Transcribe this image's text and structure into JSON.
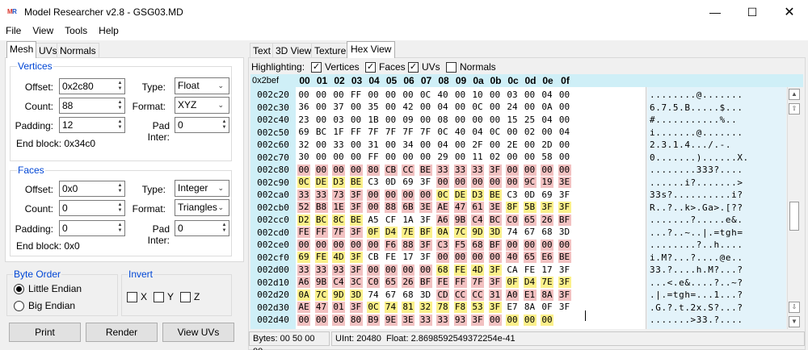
{
  "title": {
    "logo": "MR",
    "text": "Model Researcher v2.8 - GSG03.MD"
  },
  "menu": [
    "File",
    "View",
    "Tools",
    "Help"
  ],
  "left_tabs": [
    "Mesh",
    "UVs",
    "Normals"
  ],
  "vertices": {
    "title": "Vertices",
    "offset_label": "Offset:",
    "offset": "0x2c80",
    "count_label": "Count:",
    "count": "88",
    "padding_label": "Padding:",
    "padding": "12",
    "type_label": "Type:",
    "type": "Float",
    "format_label": "Format:",
    "format": "XYZ",
    "padinter_label": "Pad Inter:",
    "padinter": "0",
    "endblock": "End block: 0x34c0"
  },
  "faces": {
    "title": "Faces",
    "offset_label": "Offset:",
    "offset": "0x0",
    "count_label": "Count:",
    "count": "0",
    "padding_label": "Padding:",
    "padding": "0",
    "type_label": "Type:",
    "type": "Integer",
    "format_label": "Format:",
    "format": "Triangles",
    "padinter_label": "Pad Inter:",
    "padinter": "0",
    "endblock": "End block: 0x0"
  },
  "byte_order": {
    "title": "Byte Order",
    "little": "Little Endian",
    "big": "Big Endian",
    "selected": "Little Endian"
  },
  "invert": {
    "title": "Invert",
    "x": "X",
    "y": "Y",
    "z": "Z"
  },
  "buttons": {
    "print": "Print",
    "render": "Render",
    "view_uvs": "View UVs"
  },
  "right_tabs": [
    "Text",
    "3D View",
    "Texture",
    "Hex View"
  ],
  "highlighting": {
    "label": "Highlighting:",
    "vertices": "Vertices",
    "faces": "Faces",
    "uvs": "UVs",
    "normals": "Normals",
    "checked": [
      "Vertices",
      "Faces",
      "UVs"
    ]
  },
  "hex": {
    "cursor": "0x2bef",
    "columns": [
      "00",
      "01",
      "02",
      "03",
      "04",
      "05",
      "06",
      "07",
      "08",
      "09",
      "0a",
      "0b",
      "0c",
      "0d",
      "0e",
      "0f"
    ],
    "rows": [
      {
        "offset": "002c20",
        "bytes": "00 00 00 FF 00 00 00 0C 40 00 10 00 03 00 04 00",
        "hl": "................",
        "ascii": "........@......."
      },
      {
        "offset": "002c30",
        "bytes": "36 00 37 00 35 00 42 00 04 00 0C 00 24 00 0A 00",
        "hl": "................",
        "ascii": "6.7.5.B.....$..."
      },
      {
        "offset": "002c40",
        "bytes": "23 00 03 00 1B 00 09 00 08 00 00 00 15 25 04 00",
        "hl": "................",
        "ascii": "#...........%.."
      },
      {
        "offset": "002c50",
        "bytes": "69 BC 1F FF 7F 7F 7F 7F 0C 40 04 0C 00 02 00 04 00",
        "hl": "................",
        "ascii": "i.......@......."
      },
      {
        "offset": "002c60",
        "bytes": "32 00 33 00 31 00 34 00 04 00 2F 00 2E 00 2D 00",
        "hl": "................",
        "ascii": "2.3.1.4.../.-."
      },
      {
        "offset": "002c70",
        "bytes": "30 00 00 00 FF 00 00 00 29 00 11 02 00 00 58 00",
        "hl": "................",
        "ascii": "0.......)......X."
      },
      {
        "offset": "002c80",
        "bytes": "00 00 00 00 80 CB CC BE 33 33 33 3F 00 00 00 00",
        "hl": "rrrrrrrrrrrrrrrr",
        "ascii": "........333?...."
      },
      {
        "offset": "002c90",
        "bytes": "0C DE D3 BE C3 0D 69 3F 00 00 00 00 00 9C 19 3E",
        "hl": "yyyy....rrrrrrrr",
        "ascii": "......i?.......>"
      },
      {
        "offset": "002ca0",
        "bytes": "33 33 73 3F 00 00 00 00 0C DE D3 BE C3 0D 69 3F",
        "hl": "rrrrrrrryyyy....",
        "ascii": "33s?..........i?"
      },
      {
        "offset": "002cb0",
        "bytes": "52 B8 1E 3F 00 88 6B 3E AE 47 61 3E 8F 5B 3F 3F",
        "hl": "rrrrrrrrrrrryyyy",
        "ascii": "R..?..k>.Ga>.[??"
      },
      {
        "offset": "002cc0",
        "bytes": "D2 BC 8C BE A5 CF 1A 3F A6 9B C4 BC C0 65 26 BF",
        "hl": "yyyy....rrrrrrrr",
        "ascii": ".......?.....e&."
      },
      {
        "offset": "002cd0",
        "bytes": "FE FF 7F 3F 0F D4 7E BF 0A 7C 9D 3D 74 67 68 3D",
        "hl": "rrrryyyyyyyy....",
        "ascii": "...?..~..|.=tgh="
      },
      {
        "offset": "002ce0",
        "bytes": "00 00 00 00 00 F6 88 3F C3 F5 68 BF 00 00 00 00",
        "hl": "rrrrrrrrrrrrrrrr",
        "ascii": "........?..h...."
      },
      {
        "offset": "002cf0",
        "bytes": "69 FE 4D 3F CB FE 17 3F 00 00 00 00 40 65 E6 BE",
        "hl": "yyyy....rrrrrrrr",
        "ascii": "i.M?...?....@e.."
      },
      {
        "offset": "002d00",
        "bytes": "33 33 93 3F 00 00 00 00 68 FE 4D 3F CA FE 17 3F",
        "hl": "rrrrrrrryyyy....",
        "ascii": "33.?....h.M?...?"
      },
      {
        "offset": "002d10",
        "bytes": "A6 9B C4 3C C0 65 26 BF FE FF 7F 3F 0F D4 7E 3F",
        "hl": "rrrrrrrrrrrryyyy",
        "ascii": "...<.e&....?..~?"
      },
      {
        "offset": "002d20",
        "bytes": "0A 7C 9D 3D 74 67 68 3D CD CC CC 31 A0 E1 8A 3F",
        "hl": "yyyy....rrrrrrrr",
        "ascii": ".|.=tgh=...1...?"
      },
      {
        "offset": "002d30",
        "bytes": "AE 47 01 3F 0C 74 81 32 78 F8 53 3F E7 8A 0F 3F",
        "hl": "rrrryyyyyyyy....",
        "ascii": ".G.?.t.2x.S?...?"
      },
      {
        "offset": "002d40",
        "bytes": "00 00 00 80 B9 9E 3E 33 33 93 3F 00 00 00 00",
        "hl": "rrrrrrrrrrrryyyy",
        "ascii": ".......>33.?...."
      }
    ]
  },
  "status": {
    "bytes": "Bytes: 00 50 00 00",
    "uint": "UInt: 20480",
    "float": "Float: 2.8698592549372254e-41"
  },
  "colors": {
    "vertex_hl": "#f2c1c1",
    "face_hl": "#fbf08a",
    "hex_header": "#cfeff7",
    "group_title": "#0046d5"
  }
}
